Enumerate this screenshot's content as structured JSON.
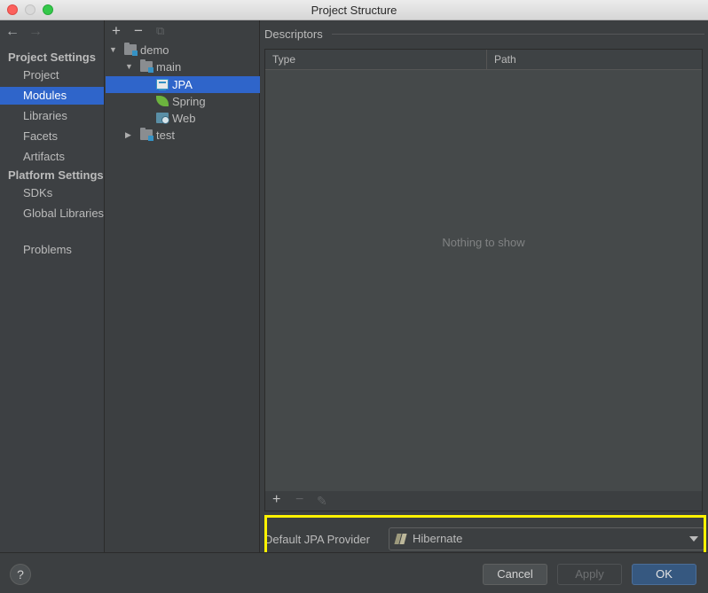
{
  "window": {
    "title": "Project Structure"
  },
  "nav": {
    "back": "←",
    "forward": "→",
    "project_settings_header": "Project Settings",
    "project_settings_items": [
      {
        "label": "Project",
        "selected": false
      },
      {
        "label": "Modules",
        "selected": true
      },
      {
        "label": "Libraries",
        "selected": false
      },
      {
        "label": "Facets",
        "selected": false
      },
      {
        "label": "Artifacts",
        "selected": false
      }
    ],
    "platform_settings_header": "Platform Settings",
    "platform_settings_items": [
      {
        "label": "SDKs"
      },
      {
        "label": "Global Libraries"
      }
    ],
    "problems": "Problems"
  },
  "tree": {
    "toolbar": {
      "add": "+",
      "remove": "−",
      "copy": "⧉"
    },
    "nodes": [
      {
        "label": "demo",
        "icon": "module-folder-icon",
        "expanded": true
      },
      {
        "label": "main",
        "icon": "module-folder-icon",
        "expanded": true
      },
      {
        "label": "JPA",
        "icon": "jpa-facet-icon",
        "selected": true
      },
      {
        "label": "Spring",
        "icon": "spring-facet-icon"
      },
      {
        "label": "Web",
        "icon": "web-facet-icon"
      },
      {
        "label": "test",
        "icon": "folder-icon",
        "expanded": false
      }
    ]
  },
  "descriptors": {
    "title": "Descriptors",
    "columns": [
      "Type",
      "Path"
    ],
    "empty_text": "Nothing to show",
    "toolbar": {
      "add": "+",
      "remove": "−",
      "edit": "✎"
    }
  },
  "provider": {
    "label": "Default JPA Provider",
    "value": "Hibernate",
    "icon": "hibernate-icon"
  },
  "buttons": {
    "help": "?",
    "cancel": "Cancel",
    "apply": "Apply",
    "ok": "OK"
  },
  "colors": {
    "selection": "#2f65ca",
    "highlight": "#fff200",
    "ok_button": "#365880"
  }
}
